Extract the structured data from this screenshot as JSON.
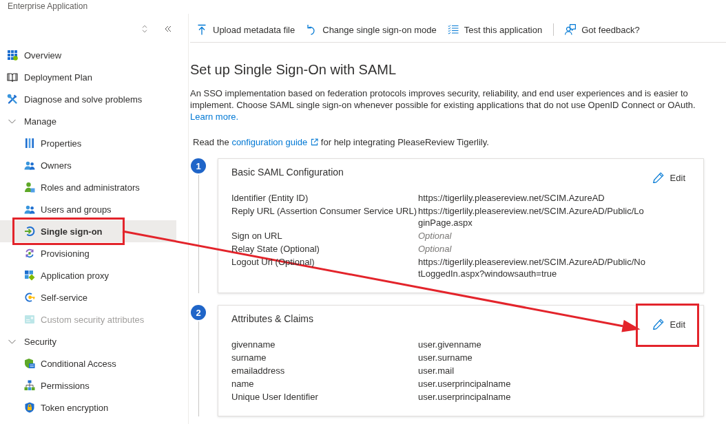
{
  "window": {
    "title": "Enterprise Application"
  },
  "sidebar": {
    "items": [
      {
        "kind": "link",
        "label": "Overview",
        "selected": false,
        "disabled": false,
        "highlighted": false
      },
      {
        "kind": "link",
        "label": "Deployment Plan",
        "selected": false,
        "disabled": false,
        "highlighted": false
      },
      {
        "kind": "link",
        "label": "Diagnose and solve problems",
        "selected": false,
        "disabled": false,
        "highlighted": false
      },
      {
        "kind": "group",
        "label": "Manage",
        "expanded": true,
        "children": [
          {
            "label": "Properties",
            "selected": false,
            "disabled": false,
            "highlighted": false
          },
          {
            "label": "Owners",
            "selected": false,
            "disabled": false,
            "highlighted": false
          },
          {
            "label": "Roles and administrators",
            "selected": false,
            "disabled": false,
            "highlighted": false
          },
          {
            "label": "Users and groups",
            "selected": false,
            "disabled": false,
            "highlighted": false
          },
          {
            "label": "Single sign-on",
            "selected": true,
            "disabled": false,
            "highlighted": true
          },
          {
            "label": "Provisioning",
            "selected": false,
            "disabled": false,
            "highlighted": false
          },
          {
            "label": "Application proxy",
            "selected": false,
            "disabled": false,
            "highlighted": false
          },
          {
            "label": "Self-service",
            "selected": false,
            "disabled": false,
            "highlighted": false
          },
          {
            "label": "Custom security attributes",
            "selected": false,
            "disabled": true,
            "highlighted": false
          }
        ]
      },
      {
        "kind": "group",
        "label": "Security",
        "expanded": true,
        "children": [
          {
            "label": "Conditional Access",
            "selected": false,
            "disabled": false,
            "highlighted": false
          },
          {
            "label": "Permissions",
            "selected": false,
            "disabled": false,
            "highlighted": false
          },
          {
            "label": "Token encryption",
            "selected": false,
            "disabled": false,
            "highlighted": false
          }
        ]
      }
    ]
  },
  "toolbar": {
    "actions": [
      {
        "label": "Upload metadata file"
      },
      {
        "label": "Change single sign-on mode"
      },
      {
        "label": "Test this application"
      }
    ],
    "feedback": {
      "label": "Got feedback?"
    }
  },
  "page": {
    "heading": "Set up Single Sign-On with SAML",
    "intro": "An SSO implementation based on federation protocols improves security, reliability, and end user experiences and is easier to implement. Choose SAML single sign-on whenever possible for existing applications that do not use OpenID Connect or OAuth.",
    "intro_link": "Learn more.",
    "guide": {
      "before": "Read the",
      "link": "configuration guide",
      "after": "for help integrating PleaseReview Tigerlily."
    }
  },
  "steps": [
    {
      "number": "1",
      "title": "Basic SAML Configuration",
      "edit": {
        "label": "Edit",
        "highlighted": false
      },
      "rows": [
        {
          "label": "Identifier (Entity ID)",
          "value": "https://tigerlily.pleasereview.net/SCIM.AzureAD",
          "unset": false
        },
        {
          "label": "Reply URL (Assertion Consumer Service URL)",
          "value": "https://tigerlily.pleasereview.net/SCIM.AzureAD/Public/LoginPage.aspx",
          "unset": false
        },
        {
          "label": "Sign on URL",
          "value": "Optional",
          "unset": true
        },
        {
          "label": "Relay State (Optional)",
          "value": "Optional",
          "unset": true
        },
        {
          "label": "Logout Url (Optional)",
          "value": "https://tigerlily.pleasereview.net/SCIM.AzureAD/Public/NotLoggedIn.aspx?windowsauth=true",
          "unset": false
        }
      ]
    },
    {
      "number": "2",
      "title": "Attributes & Claims",
      "edit": {
        "label": "Edit",
        "highlighted": true
      },
      "rows": [
        {
          "label": "givenname",
          "value": "user.givenname",
          "unset": false
        },
        {
          "label": "surname",
          "value": "user.surname",
          "unset": false
        },
        {
          "label": "emailaddress",
          "value": "user.mail",
          "unset": false
        },
        {
          "label": "name",
          "value": "user.userprincipalname",
          "unset": false
        },
        {
          "label": "Unique User Identifier",
          "value": "user.userprincipalname",
          "unset": false
        }
      ]
    }
  ]
}
